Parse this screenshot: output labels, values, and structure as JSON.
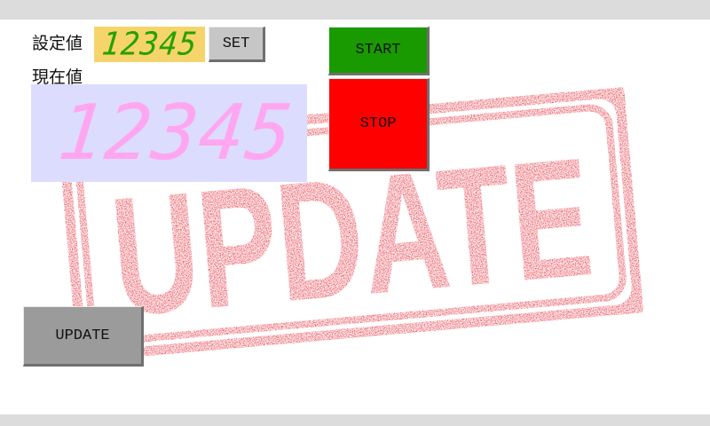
{
  "labels": {
    "setpoint": "設定値",
    "current": "現在値"
  },
  "values": {
    "setpoint_display": "12345",
    "current_display": "12345"
  },
  "buttons": {
    "set": "SET",
    "start": "START",
    "stop": "STOP",
    "update": "UPDATE"
  },
  "background_image": {
    "stamp_text": "UPDATE",
    "icon": "update-stamp-icon"
  },
  "colors": {
    "setpoint_lcd_bg": "#f6d46c",
    "setpoint_lcd_digits": "#26a100",
    "current_lcd_bg": "#dcdcff",
    "current_lcd_digits": "#ffa6f1",
    "start_button": "#199a00",
    "stop_button": "#ff0000",
    "stamp_red": "#e0101c"
  }
}
